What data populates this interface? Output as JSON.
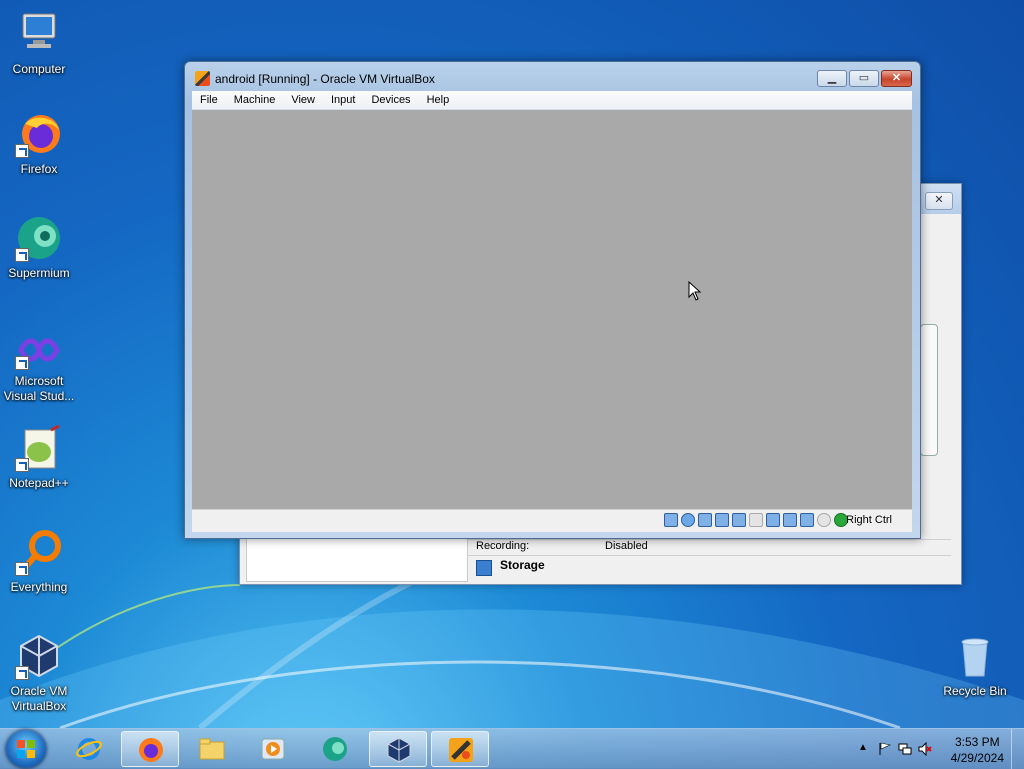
{
  "desktop": {
    "icons": [
      {
        "label": "Computer"
      },
      {
        "label": "Firefox"
      },
      {
        "label": "Supermium"
      },
      {
        "label": "Microsoft Visual Stud..."
      },
      {
        "label": "Notepad++"
      },
      {
        "label": "Everything"
      },
      {
        "label": "Oracle VM VirtualBox"
      },
      {
        "label": "Recycle Bin"
      }
    ]
  },
  "vm_window": {
    "title": "android [Running] - Oracle VM VirtualBox",
    "menu": [
      "File",
      "Machine",
      "View",
      "Input",
      "Devices",
      "Help"
    ],
    "host_key": "Right Ctrl",
    "status_icons": [
      "hard-disk-icon",
      "optical-drive-icon",
      "audio-icon",
      "network-icon",
      "usb-icon",
      "shared-folders-icon",
      "display-icon",
      "recording-icon",
      "cpu-icon",
      "mouse-integration-icon",
      "keyboard-capture-icon"
    ]
  },
  "manager_window": {
    "recording_label": "Recording:",
    "recording_value": "Disabled",
    "storage_label": "Storage"
  },
  "taskbar": {
    "apps": [
      "start-button",
      "internet-explorer",
      "firefox",
      "file-explorer",
      "media-player",
      "supermium",
      "virtualbox-manager",
      "virtualbox-vm"
    ],
    "clock_time": "3:53 PM",
    "clock_date": "4/29/2024"
  }
}
